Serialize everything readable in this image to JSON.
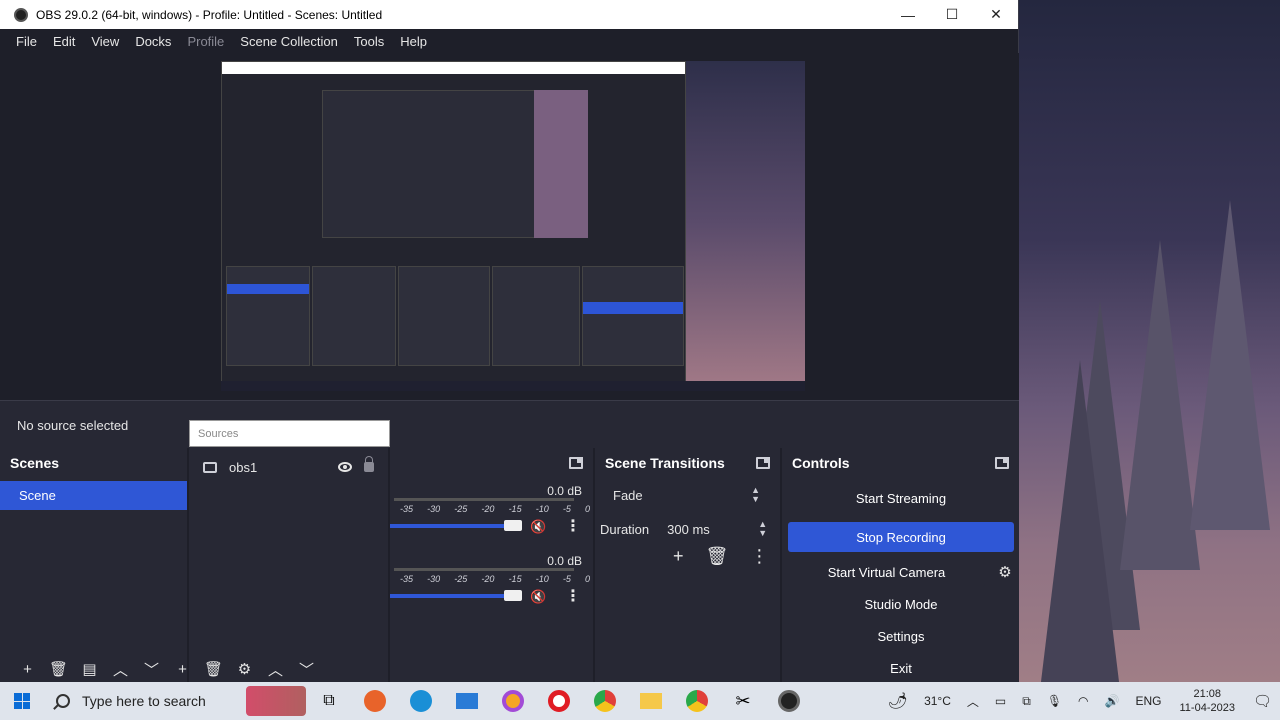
{
  "window": {
    "title": "OBS 29.0.2 (64-bit, windows) - Profile: Untitled - Scenes: Untitled",
    "minimize": "—",
    "maximize": "☐",
    "close": "✕"
  },
  "menu": [
    "File",
    "Edit",
    "View",
    "Docks",
    "Profile",
    "Scene Collection",
    "Tools",
    "Help"
  ],
  "status": {
    "no_source": "No source selected",
    "sources_tooltip": "Sources"
  },
  "scenes": {
    "title": "Scenes",
    "items": [
      "Scene"
    ]
  },
  "sources": {
    "items": [
      "obs1"
    ]
  },
  "mixer": {
    "channels": [
      {
        "db": "0.0 dB"
      },
      {
        "db": "0.0 dB"
      }
    ],
    "ticks": [
      "-35",
      "-30",
      "-25",
      "-20",
      "-15",
      "-10",
      "-5",
      "0"
    ]
  },
  "transitions": {
    "title": "Scene Transitions",
    "selected": "Fade",
    "duration_label": "Duration",
    "duration_value": "300 ms"
  },
  "controls": {
    "title": "Controls",
    "start_streaming": "Start Streaming",
    "stop_recording": "Stop Recording",
    "start_virtual_camera": "Start Virtual Camera",
    "studio_mode": "Studio Mode",
    "settings": "Settings",
    "exit": "Exit"
  },
  "taskbar": {
    "search_placeholder": "Type here to search",
    "weather": "31°C",
    "language": "ENG",
    "time": "21:08",
    "date": "11-04-2023"
  },
  "colors": {
    "accent": "#2f57d6",
    "panel": "#272834",
    "background": "#1e1f29"
  }
}
